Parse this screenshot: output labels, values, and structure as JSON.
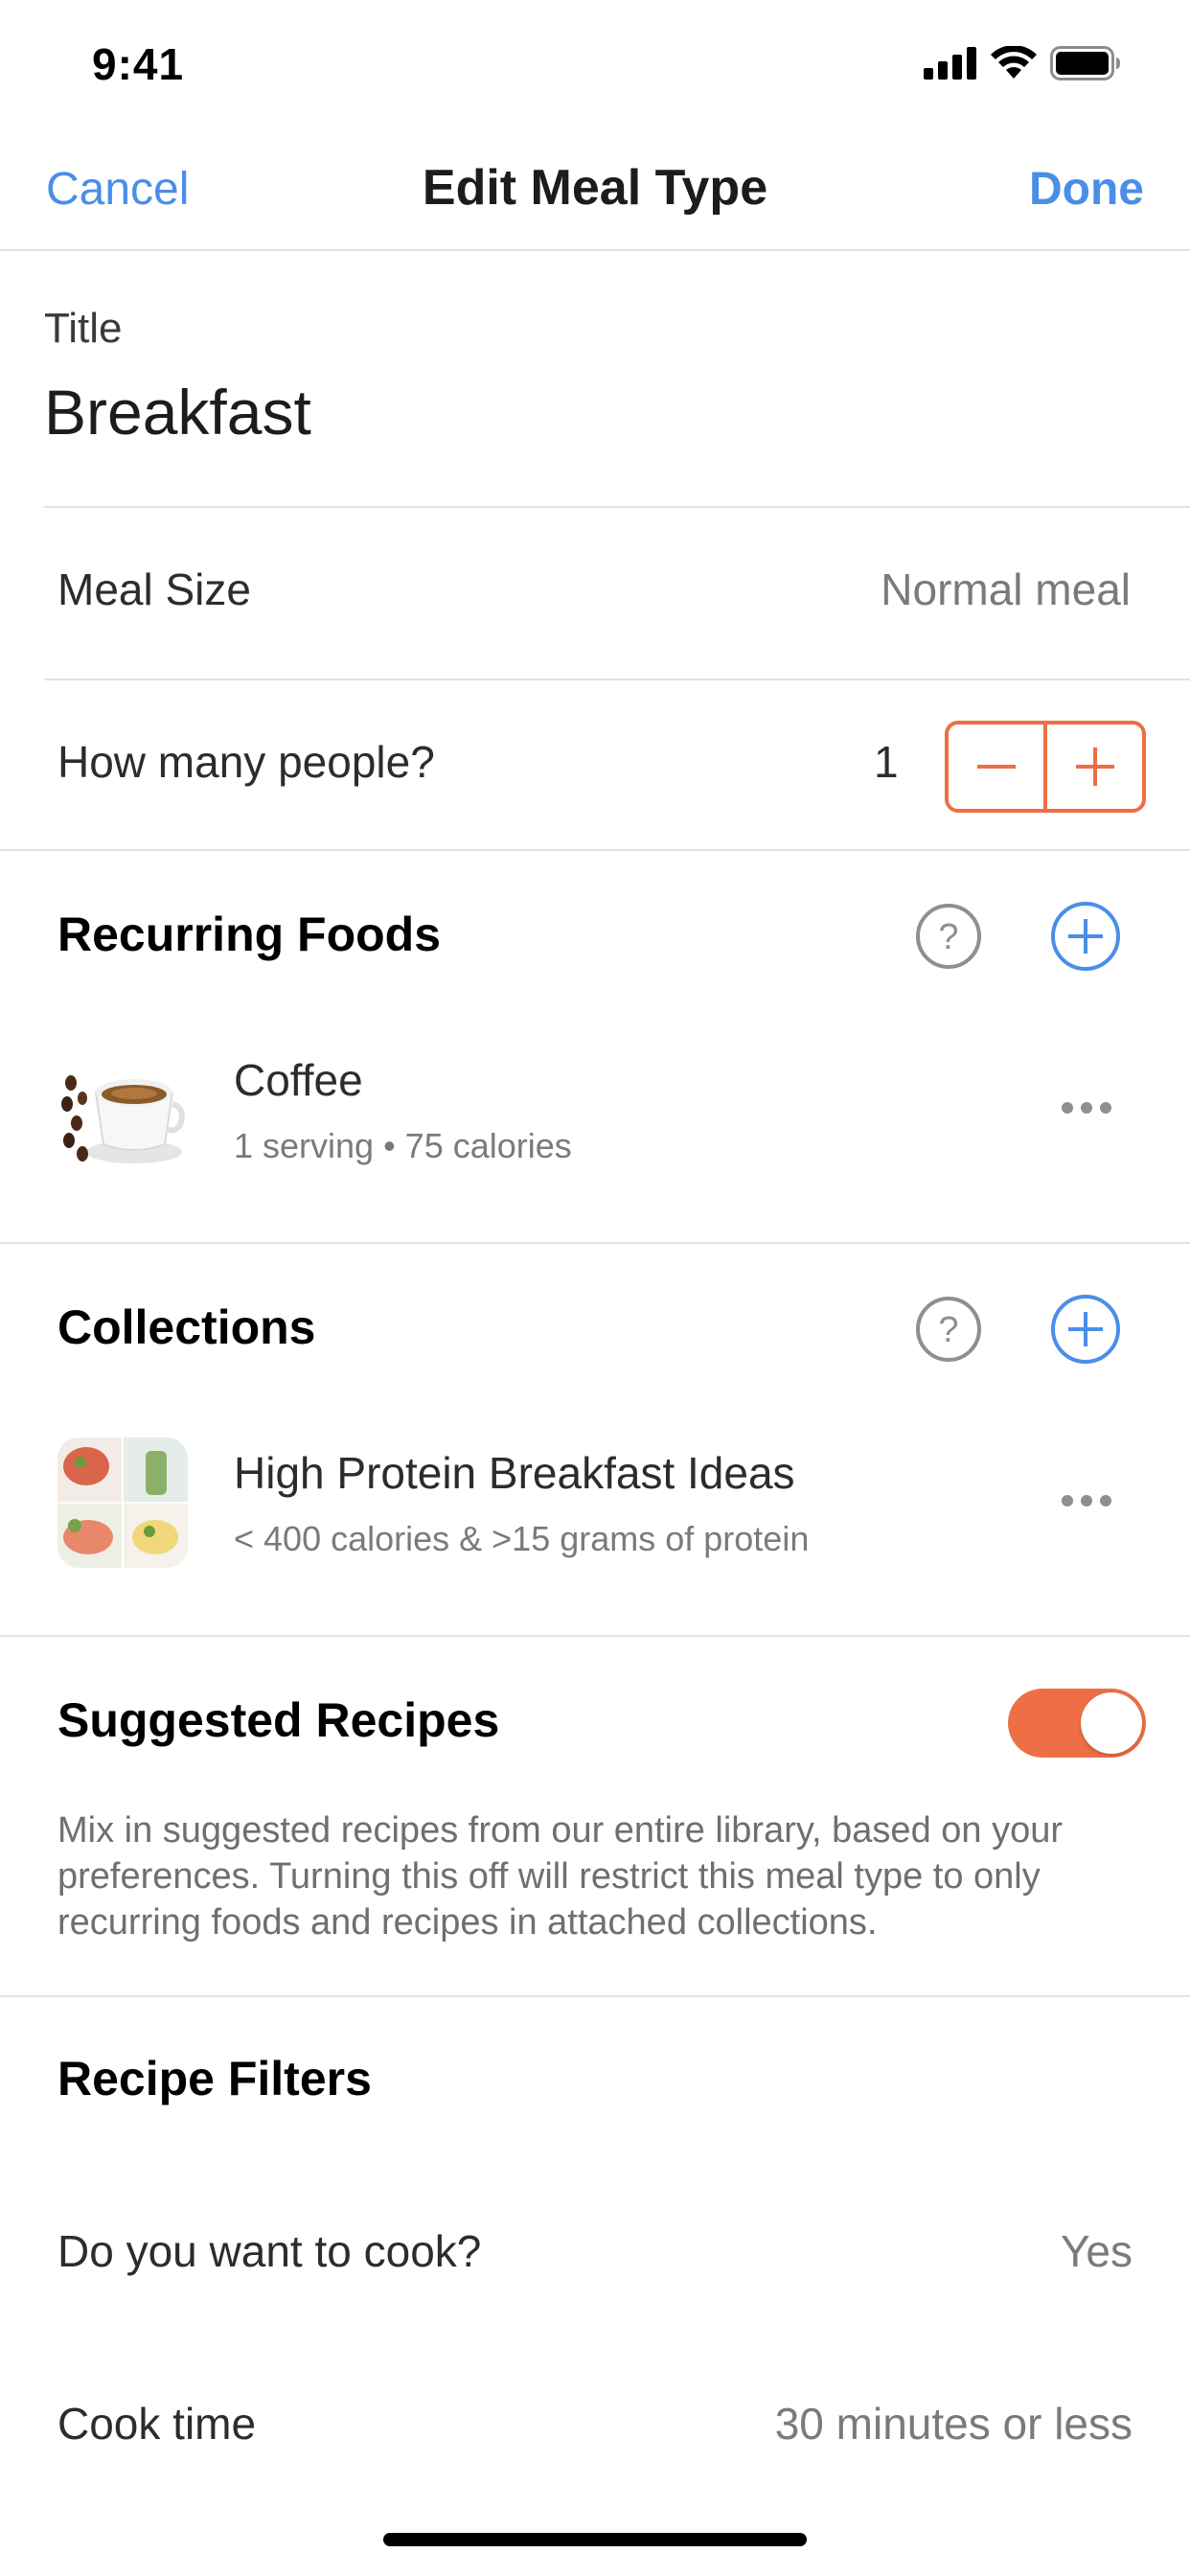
{
  "status_bar": {
    "time": "9:41",
    "icons": [
      "cellular-signal-icon",
      "wifi-icon",
      "battery-icon"
    ]
  },
  "nav": {
    "cancel_label": "Cancel",
    "title": "Edit Meal Type",
    "done_label": "Done"
  },
  "title_field": {
    "label": "Title",
    "value": "Breakfast"
  },
  "meal_size": {
    "label": "Meal Size",
    "value": "Normal meal"
  },
  "people": {
    "label": "How many people?",
    "count": "1",
    "decrement_icon": "minus-icon",
    "increment_icon": "plus-icon"
  },
  "recurring_foods": {
    "heading": "Recurring Foods",
    "items": [
      {
        "title": "Coffee",
        "subtitle": "1 serving • 75 calories",
        "icon": "coffee-cup-thumbnail"
      }
    ]
  },
  "collections": {
    "heading": "Collections",
    "items": [
      {
        "title": "High Protein Breakfast Ideas",
        "subtitle": "< 400 calories & >15 grams of protein",
        "icon": "collection-thumbnail"
      }
    ]
  },
  "suggested_recipes": {
    "heading": "Suggested Recipes",
    "enabled": true,
    "description": "Mix in suggested recipes from our entire library, based on your preferences. Turning this off will restrict this meal type to only recurring foods and recipes in attached collections."
  },
  "recipe_filters": {
    "heading": "Recipe Filters",
    "rows": [
      {
        "label": "Do you want to cook?",
        "value": "Yes"
      },
      {
        "label": "Cook time",
        "value": "30 minutes or less"
      }
    ]
  },
  "colors": {
    "accent_blue": "#4a8ee8",
    "accent_orange": "#ee6f46",
    "divider": "#e2e2e4",
    "secondary_text": "#7a7a7e"
  }
}
